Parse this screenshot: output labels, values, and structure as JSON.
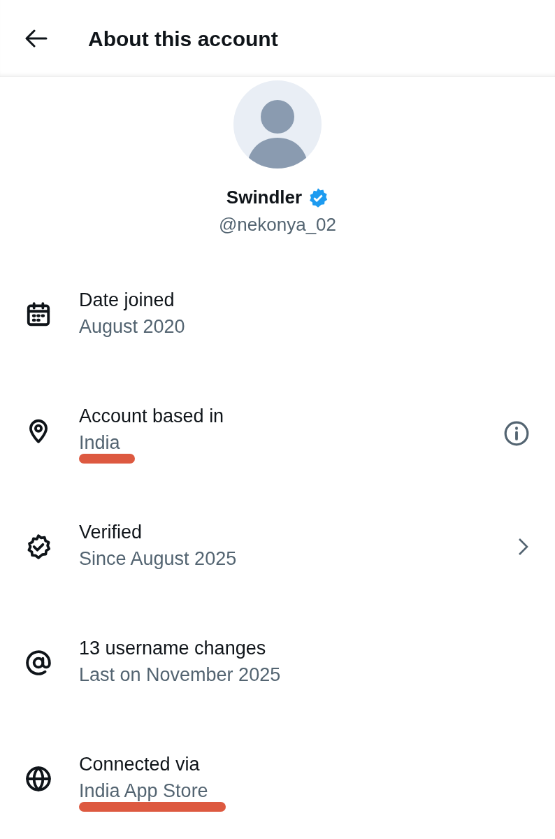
{
  "header": {
    "title": "About this account"
  },
  "profile": {
    "name": "Swindler",
    "verified": true,
    "handle": "@nekonya_02"
  },
  "rows": [
    {
      "kind": "joined",
      "title": "Date joined",
      "value": "August 2020",
      "underlined": false
    },
    {
      "kind": "location",
      "title": "Account based in",
      "value": "India",
      "underlined": true
    },
    {
      "kind": "verified",
      "title": "Verified",
      "value": "Since August 2025",
      "underlined": false
    },
    {
      "kind": "username",
      "title": "13 username changes",
      "value": "Last on November 2025",
      "underlined": false
    },
    {
      "kind": "connection",
      "title": "Connected via",
      "value": "India App Store",
      "underlined": true
    }
  ]
}
